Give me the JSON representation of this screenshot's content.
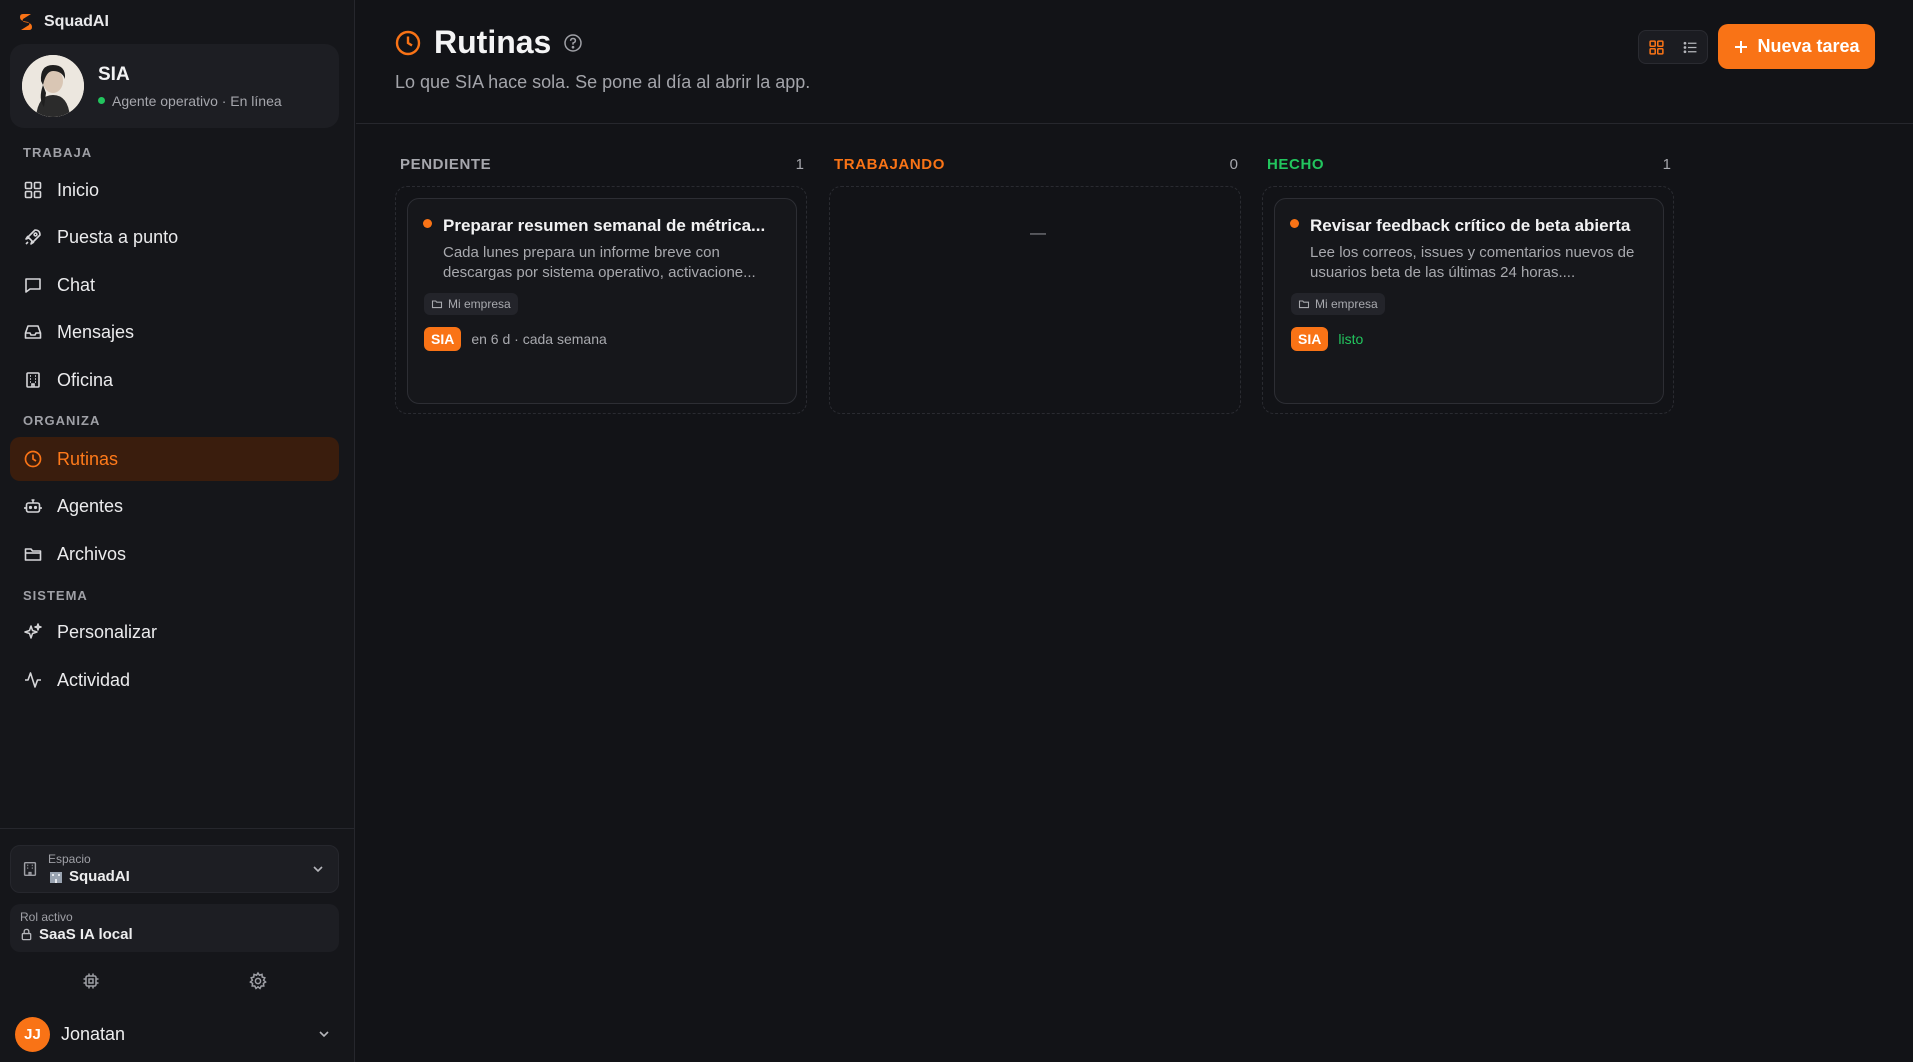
{
  "app": {
    "name": "SquadAI"
  },
  "agent": {
    "name": "SIA",
    "status": "Agente operativo · En línea"
  },
  "sidebar": {
    "sections": [
      {
        "label": "TRABAJA",
        "items": [
          {
            "label": "Inicio",
            "icon": "grid-icon"
          },
          {
            "label": "Puesta a punto",
            "icon": "rocket-icon"
          },
          {
            "label": "Chat",
            "icon": "chat-icon"
          },
          {
            "label": "Mensajes",
            "icon": "inbox-icon"
          },
          {
            "label": "Oficina",
            "icon": "building-icon"
          }
        ]
      },
      {
        "label": "ORGANIZA",
        "items": [
          {
            "label": "Rutinas",
            "icon": "clock-icon",
            "active": true
          },
          {
            "label": "Agentes",
            "icon": "bot-icon"
          },
          {
            "label": "Archivos",
            "icon": "folder-icon"
          }
        ]
      },
      {
        "label": "SISTEMA",
        "items": [
          {
            "label": "Personalizar",
            "icon": "sparkles-icon"
          },
          {
            "label": "Actividad",
            "icon": "activity-icon"
          }
        ]
      }
    ],
    "workspace": {
      "label": "Espacio",
      "value": "SquadAI"
    },
    "role": {
      "label": "Rol activo",
      "value": "SaaS IA local"
    },
    "user": {
      "initials": "JJ",
      "name": "Jonatan"
    }
  },
  "header": {
    "title": "Rutinas",
    "subtitle": "Lo que SIA hace sola. Se pone al día al abrir la app.",
    "new_button": "Nueva tarea"
  },
  "columns": [
    {
      "title": "PENDIENTE",
      "count": "1",
      "color": "#a6a7ad",
      "card": {
        "title": "Preparar resumen semanal de métrica...",
        "desc": "Cada lunes prepara un informe breve con descargas por sistema operativo, activacione...",
        "tag": "Mi empresa",
        "badge": "SIA",
        "meta": "en 6 d · cada semana"
      }
    },
    {
      "title": "TRABAJANDO",
      "count": "0",
      "color": "#f97316",
      "empty": "—"
    },
    {
      "title": "HECHO",
      "count": "1",
      "color": "#22c55e",
      "card": {
        "title": "Revisar feedback crítico de beta abierta",
        "desc": "Lee los correos, issues y comentarios nuevos de usuarios beta de las últimas 24 horas....",
        "tag": "Mi empresa",
        "badge": "SIA",
        "meta": "listo"
      }
    }
  ],
  "colors": {
    "accent": "#f97316",
    "success": "#22c55e",
    "background": "#121317"
  }
}
